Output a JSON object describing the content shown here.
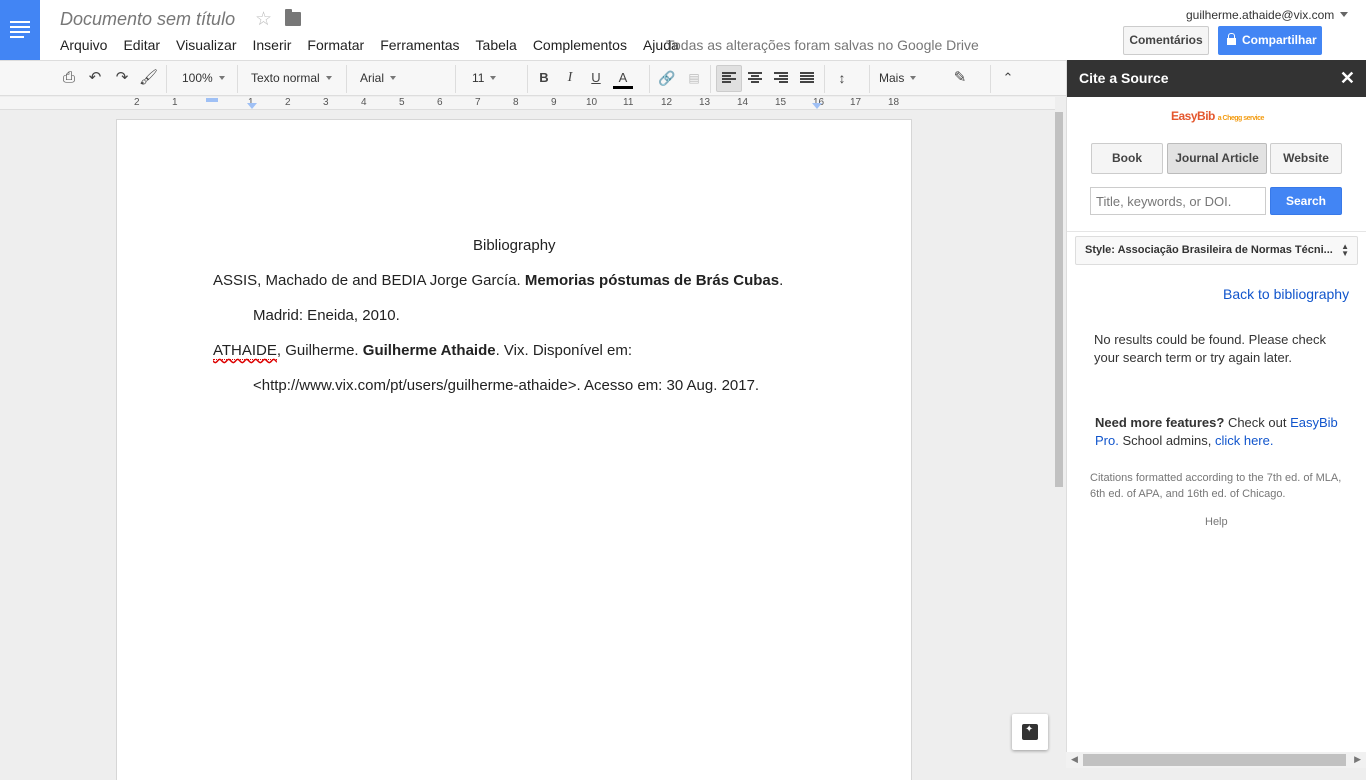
{
  "header": {
    "title": "Documento sem título",
    "menu": [
      "Arquivo",
      "Editar",
      "Visualizar",
      "Inserir",
      "Formatar",
      "Ferramentas",
      "Tabela",
      "Complementos",
      "Ajuda"
    ],
    "save_status": "Todas as alterações foram salvas no Google Drive",
    "account": "guilherme.athaide@vix.com",
    "comments_label": "Comentários",
    "share_label": "Compartilhar"
  },
  "toolbar": {
    "zoom": "100%",
    "style": "Texto normal",
    "font": "Arial",
    "size": "11",
    "more": "Mais"
  },
  "ruler": {
    "numbers": [
      "2",
      "1",
      "1",
      "2",
      "3",
      "4",
      "5",
      "6",
      "7",
      "8",
      "9",
      "10",
      "11",
      "12",
      "13",
      "14",
      "15",
      "16",
      "17",
      "18"
    ]
  },
  "document": {
    "heading": "Bibliography",
    "ref1_plain": "ASSIS, Machado de and BEDIA Jorge García. ",
    "ref1_bold": "Memorias póstumas de Brás Cubas",
    "ref1_end": ".",
    "ref1_line2": "Madrid: Eneida, 2010.",
    "ref2_spell": "ATHAIDE",
    "ref2_plain": ", Guilherme. ",
    "ref2_bold": "Guilherme Athaide",
    "ref2_end": ". Vix. Disponível em:",
    "ref2_line2": "<http://www.vix.com/pt/users/guilherme-athaide>. Acesso em: 30 Aug. 2017."
  },
  "panel": {
    "title": "Cite a Source",
    "logo": "EasyBib",
    "logo_sub": "a Chegg service",
    "tabs": [
      "Book",
      "Journal Article",
      "Website"
    ],
    "selected_tab": "Journal Article",
    "search_placeholder": "Title, keywords, or DOI.",
    "search_label": "Search",
    "style_label": "Style: Associação Brasileira de Normas Técni...",
    "back_link": "Back to bibliography",
    "no_results": "No results could be found. Please check your search term or try again later.",
    "features_bold": "Need more features?",
    "features_text1": " Check out ",
    "features_link1": "EasyBib Pro.",
    "features_text2": " School admins, ",
    "features_link2": "click here.",
    "formatted_note": "Citations formatted according to the 7th ed. of MLA, 6th ed. of APA, and 16th ed. of Chicago.",
    "help": "Help"
  },
  "colors": {
    "accent": "#4285f4",
    "link": "#1155cc",
    "panel_header": "#333333"
  }
}
